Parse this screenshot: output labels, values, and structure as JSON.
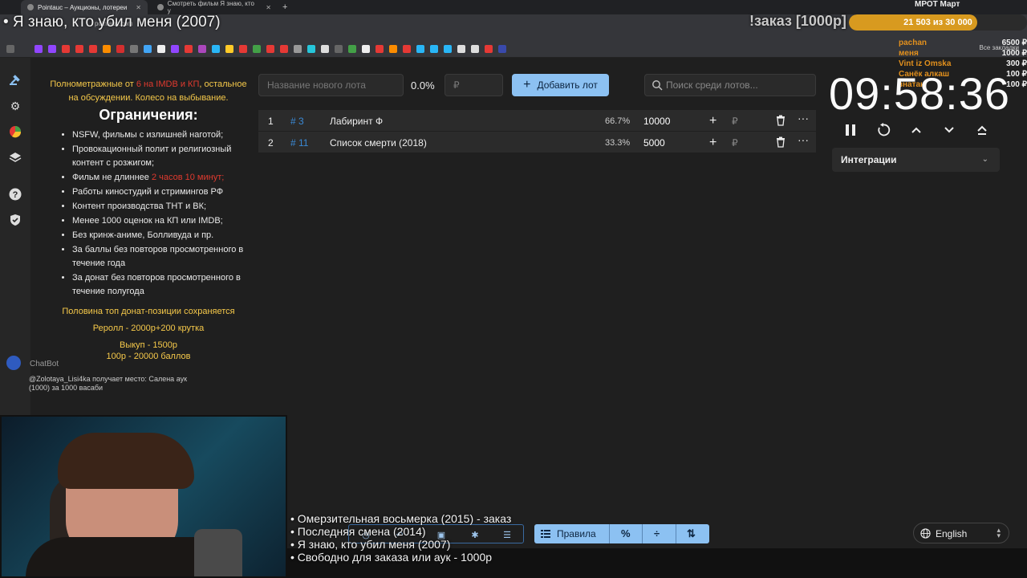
{
  "browser": {
    "tabs": [
      {
        "label": "Pointauc – Аукционы, лотереи",
        "active": true
      },
      {
        "label": "Смотреть фильм Я знаю, кто у",
        "active": false
      }
    ],
    "url": "pointauc.com",
    "all_bookmarks": "Все закладки"
  },
  "overlay": {
    "current_title": "• Я знаю, кто убил меня (2007)",
    "order_label": "!заказ [1000р]",
    "mrot_label": "МРОТ Март",
    "goal": {
      "text": "21 503  из 30 000",
      "progress": 0.72
    },
    "donors": [
      {
        "name": "pachan",
        "amount": "6500 ₽"
      },
      {
        "name": "меня",
        "amount": "1000 ₽"
      },
      {
        "name": "Vint iz Omska",
        "amount": "300 ₽"
      },
      {
        "name": "Санёк алкаш",
        "amount": "100 ₽"
      },
      {
        "name": "знатак",
        "amount": "100 ₽"
      }
    ]
  },
  "rules": {
    "intro_a": "Полнометражные от ",
    "intro_red": "6 на IMDB и КП",
    "intro_b": ", остальное на обсуждении. Колесо на выбывание.",
    "heading": "Ограничения:",
    "items": [
      "NSFW, фильмы с излишней наготой;",
      "Провокационный полит и религиозный контент с розжигом;",
      "Фильм не длиннее ",
      "Работы киностудий и стримингов РФ",
      "Контент производства ТНТ и ВК;",
      "Менее 1000 оценок на КП или IMDB;",
      "Без кринж-аниме, Болливуда и пр.",
      "За баллы без повторов просмотренного в течение года",
      "За донат без повторов просмотренного в течение полугода"
    ],
    "length_red": "2 часов 10 минут;",
    "line_half": "Половина топ донат-позиции сохраняется",
    "line_reroll": "Реролл - 2000р+200 крутка",
    "line_buyout": "Выкуп - 1500р",
    "line_points": "100р - 20000 баллов"
  },
  "chatbot": {
    "name": "ChatBot",
    "message": "@Zolotaya_Lisi4ka получает место: Салена аук (1000) за 1000 васаби"
  },
  "lot_form": {
    "name_placeholder": "Название нового лота",
    "percent": "0.0%",
    "amount_placeholder": "₽",
    "add_button": "Добавить лот",
    "search_placeholder": "Поиск среди лотов..."
  },
  "lots": [
    {
      "index": "1",
      "id": "# 3",
      "name": "Лабиринт Ф",
      "percent": "66.7%",
      "amount": "10000",
      "currency": "₽"
    },
    {
      "index": "2",
      "id": "# 11",
      "name": "Список смерти (2018)",
      "percent": "33.3%",
      "amount": "5000",
      "currency": "₽"
    }
  ],
  "timer": {
    "value": "09:58:36"
  },
  "integrations": {
    "label": "Интеграции"
  },
  "order_list": [
    "• Омерзительная восьмерка (2015) - заказ",
    "• Последняя смена (2014)",
    "• Я знаю, кто убил меня (2007)",
    "• Свободно для заказа или аук - 1000р"
  ],
  "toolbar": {
    "rules_label": "Правила"
  },
  "language": {
    "selected": "English"
  },
  "colors": {
    "accent": "#8cc1f2",
    "gold": "#d89a1f",
    "red": "#e03a2f",
    "yellow": "#f6c94a",
    "link": "#3a8ad6"
  }
}
